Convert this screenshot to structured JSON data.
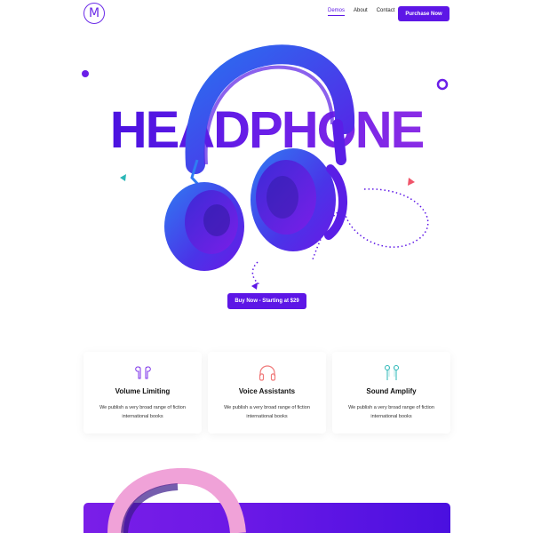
{
  "header": {
    "logo_letter": "M",
    "nav": [
      {
        "label": "Demos",
        "active": true
      },
      {
        "label": "About",
        "active": false
      },
      {
        "label": "Contact",
        "active": false
      }
    ],
    "purchase_label": "Purchase Now"
  },
  "hero": {
    "title": "HEADPHONE",
    "buy_label": "Buy Now - Starting at $29"
  },
  "features": [
    {
      "icon": "earbuds-icon",
      "title": "Volume Limiting",
      "text": "We publish a very broad range of fiction international books"
    },
    {
      "icon": "headphones-icon",
      "title": "Voice Assistants",
      "text": "We publish a very broad range of fiction international books"
    },
    {
      "icon": "earphones-icon",
      "title": "Sound Amplify",
      "text": "We publish a very broad range of fiction international books"
    }
  ],
  "colors": {
    "accent": "#5d16e6",
    "headphone_blue": "#2a6ff0",
    "headphone_purple": "#6a18e6",
    "triangle_teal": "#2bb7b7",
    "triangle_red": "#f0556a"
  }
}
